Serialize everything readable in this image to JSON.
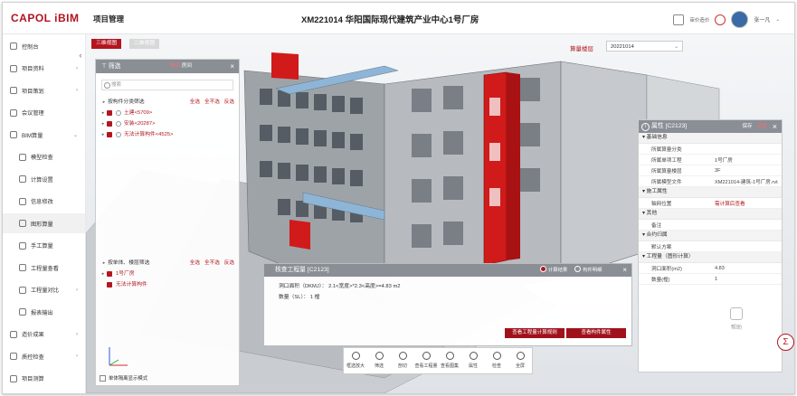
{
  "header": {
    "logo": "CAPOL iBIM",
    "app_name": "项目管理",
    "project_title": "XM221014 华阳国际现代建筑产业中心1号厂房",
    "tool_text": "审价造价",
    "user_name": "张一凡"
  },
  "sidebar": {
    "items": [
      {
        "label": "控制台",
        "icon": "dashboard-icon",
        "sub": false,
        "caret": ""
      },
      {
        "label": "项目资料",
        "icon": "folder-icon",
        "sub": false,
        "caret": ">"
      },
      {
        "label": "项目策划",
        "icon": "plan-icon",
        "sub": false,
        "caret": ">"
      },
      {
        "label": "会议管理",
        "icon": "meeting-icon",
        "sub": false,
        "caret": ""
      },
      {
        "label": "BIM算量",
        "icon": "bim-icon",
        "sub": false,
        "caret": "v"
      },
      {
        "label": "模型检查",
        "icon": "check-icon",
        "sub": true,
        "caret": ""
      },
      {
        "label": "计算设置",
        "icon": "settings-icon",
        "sub": true,
        "caret": ""
      },
      {
        "label": "信息修改",
        "icon": "edit-icon",
        "sub": true,
        "caret": ""
      },
      {
        "label": "图形算量",
        "icon": "graphic-icon",
        "sub": true,
        "caret": "",
        "active": true
      },
      {
        "label": "手工算量",
        "icon": "manual-icon",
        "sub": true,
        "caret": ""
      },
      {
        "label": "工程量查看",
        "icon": "view-icon",
        "sub": true,
        "caret": ""
      },
      {
        "label": "工程量对比",
        "icon": "compare-icon",
        "sub": true,
        "caret": ">"
      },
      {
        "label": "报表输出",
        "icon": "report-icon",
        "sub": true,
        "caret": ""
      },
      {
        "label": "造价成果",
        "icon": "cost-icon",
        "sub": false,
        "caret": ">"
      },
      {
        "label": "质控检查",
        "icon": "quality-icon",
        "sub": false,
        "caret": ">"
      },
      {
        "label": "项目测算",
        "icon": "estimate-icon",
        "sub": false,
        "caret": ""
      }
    ]
  },
  "viewport": {
    "tab_3d": "三维视图",
    "tab_2d": "二维视图",
    "floor_label": "算量楼层",
    "date_value": "20221014"
  },
  "filter_panel": {
    "title": "筛选",
    "tab_active": "构件",
    "tab_other": "房间",
    "search_placeholder": "搜索",
    "section1": {
      "label": "按构件分类筛选",
      "actions": [
        "全选",
        "全不选",
        "反选"
      ],
      "items": [
        "土建<5709>",
        "安装<20287>",
        "无法计算构件<4525>"
      ]
    },
    "section2": {
      "label": "按单体、楼层筛选",
      "actions": [
        "全选",
        "全不选",
        "反选"
      ],
      "items": [
        "1号厂房",
        "无法计算构件"
      ]
    },
    "footer": "单体隔离显示模式"
  },
  "properties": {
    "title": "属性 [C2123]",
    "action_edit": "保存",
    "action_other": "还原",
    "groups": [
      {
        "name": "基础信息",
        "rows": [
          {
            "k": "所属算量分类",
            "v": "",
            "link": false
          },
          {
            "k": "所属单项工程",
            "v": "1号厂房",
            "link": false
          },
          {
            "k": "所属算量楼层",
            "v": "3F",
            "link": false
          },
          {
            "k": "所属模型文件",
            "v": "XM221014-建筑-1号厂房.rvt",
            "link": false
          }
        ]
      },
      {
        "name": "施工属性",
        "rows": [
          {
            "k": "轴网位置",
            "v": "需计算后查看",
            "link": true
          }
        ]
      },
      {
        "name": "其他",
        "rows": [
          {
            "k": "备注",
            "v": "",
            "link": false
          }
        ]
      },
      {
        "name": "合约归属",
        "rows": [
          {
            "k": "默认方案",
            "v": "",
            "link": false
          }
        ]
      },
      {
        "name": "工程量（图形计算）",
        "rows": [
          {
            "k": "洞口面积(m2)",
            "v": "4.83",
            "link": false
          },
          {
            "k": "数量(樘)",
            "v": "1",
            "link": false
          }
        ]
      }
    ]
  },
  "quantity_dialog": {
    "title": "核查工程量 [C2123]",
    "radio_on": "计算结果",
    "radio_off": "构件明细",
    "line1": "洞口面积（DKMJ）：  2.1<宽度>*2.3<高度>=4.83 m2",
    "line2": "数量（SL）：  1 樘",
    "btn_rules": "查看工程量计算规则",
    "btn_props": "查看构件属性"
  },
  "toolbar": {
    "tools": [
      {
        "label": "框选放大",
        "icon": "zoom-box-icon"
      },
      {
        "label": "筛选",
        "icon": "filter-icon"
      },
      {
        "label": "剖切",
        "icon": "section-icon"
      },
      {
        "label": "查看工程量",
        "icon": "quantity-icon"
      },
      {
        "label": "查看图集",
        "icon": "atlas-icon"
      },
      {
        "label": "属性",
        "icon": "info-icon"
      },
      {
        "label": "检查",
        "icon": "inspect-icon"
      },
      {
        "label": "全屏",
        "icon": "fullscreen-icon"
      }
    ]
  },
  "help": {
    "label": "帮助"
  },
  "colors": {
    "accent": "#b3161f",
    "panel_header": "#8a8f96"
  }
}
